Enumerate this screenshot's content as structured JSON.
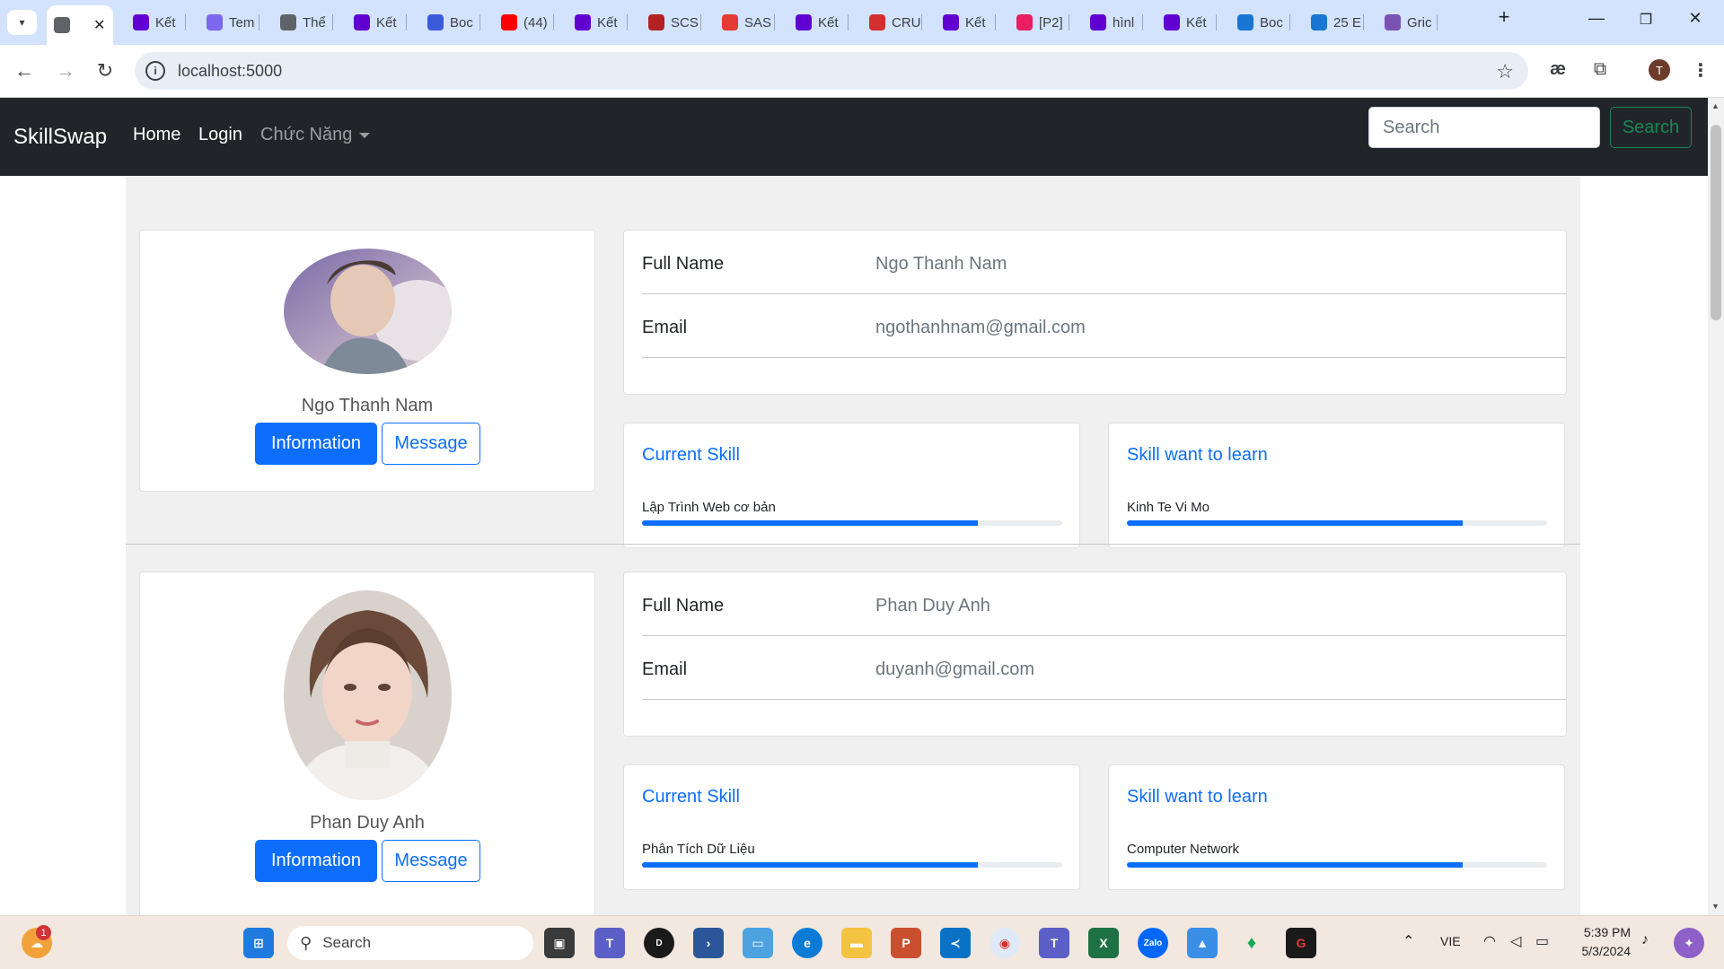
{
  "browser": {
    "tabs": [
      {
        "title": "",
        "favicon": "globe-icon",
        "color": "#5f6368",
        "active": true
      },
      {
        "title": "Kết",
        "favicon": "yahoo-icon",
        "color": "#6001d2"
      },
      {
        "title": "Tem",
        "favicon": "heart-icon",
        "color": "#7b68ee"
      },
      {
        "title": "Thể",
        "favicon": "globe-icon",
        "color": "#5f6368"
      },
      {
        "title": "Kết",
        "favicon": "yahoo-icon",
        "color": "#6001d2"
      },
      {
        "title": "Boc",
        "favicon": "bootstrap-icon",
        "color": "#3b5bdb"
      },
      {
        "title": "(44)",
        "favicon": "youtube-icon",
        "color": "#ff0000"
      },
      {
        "title": "Kết",
        "favicon": "yahoo-icon",
        "color": "#6001d2"
      },
      {
        "title": "SCS",
        "favicon": "scs-icon",
        "color": "#b22222"
      },
      {
        "title": "SAS",
        "favicon": "t-icon",
        "color": "#e53935"
      },
      {
        "title": "Kết",
        "favicon": "yahoo-icon",
        "color": "#6001d2"
      },
      {
        "title": "CRU",
        "favicon": "bk-icon",
        "color": "#d32f2f"
      },
      {
        "title": "Kết",
        "favicon": "yahoo-icon",
        "color": "#6001d2"
      },
      {
        "title": "[P2]",
        "favicon": "dtd-icon",
        "color": "#e91e63"
      },
      {
        "title": "hìnl",
        "favicon": "yahoo-icon",
        "color": "#6001d2"
      },
      {
        "title": "Kết",
        "favicon": "yahoo-icon",
        "color": "#6001d2"
      },
      {
        "title": "Boc",
        "favicon": "mdb-icon",
        "color": "#1976d2"
      },
      {
        "title": "25 E",
        "favicon": "mdb-icon",
        "color": "#1976d2"
      },
      {
        "title": "Gric",
        "favicon": "bootstrap-b-icon",
        "color": "#7952b3"
      }
    ],
    "url": "localhost:5000",
    "profile_initial": "T"
  },
  "navbar": {
    "brand": "SkillSwap",
    "home": "Home",
    "login": "Login",
    "features": "Chức Năng",
    "search_placeholder": "Search",
    "search_button": "Search"
  },
  "profiles": [
    {
      "name": "Ngo Thanh Nam",
      "full_name_label": "Full Name",
      "full_name": "Ngo Thanh Nam",
      "email_label": "Email",
      "email": "ngothanhnam@gmail.com",
      "info_button": "Information",
      "message_button": "Message",
      "current_skill_title": "Current Skill",
      "current_skill": "Lập Trình Web cơ bản",
      "current_skill_progress": 80,
      "want_skill_title": "Skill want to learn",
      "want_skill": "Kinh Te Vi Mo",
      "want_skill_progress": 80
    },
    {
      "name": "Phan Duy Anh",
      "full_name_label": "Full Name",
      "full_name": "Phan Duy Anh",
      "email_label": "Email",
      "email": "duyanh@gmail.com",
      "info_button": "Information",
      "message_button": "Message",
      "current_skill_title": "Current Skill",
      "current_skill": "Phân Tích Dữ Liệu",
      "current_skill_progress": 80,
      "want_skill_title": "Skill want to learn",
      "want_skill": "Computer Network",
      "want_skill_progress": 80
    }
  ],
  "taskbar": {
    "search_label": "Search",
    "notification_badge": "1",
    "language": "VIE",
    "time": "5:39 PM",
    "date": "5/3/2024"
  },
  "colors": {
    "primary": "#0d6efd",
    "navbar_bg": "#212529",
    "success": "#198754"
  }
}
